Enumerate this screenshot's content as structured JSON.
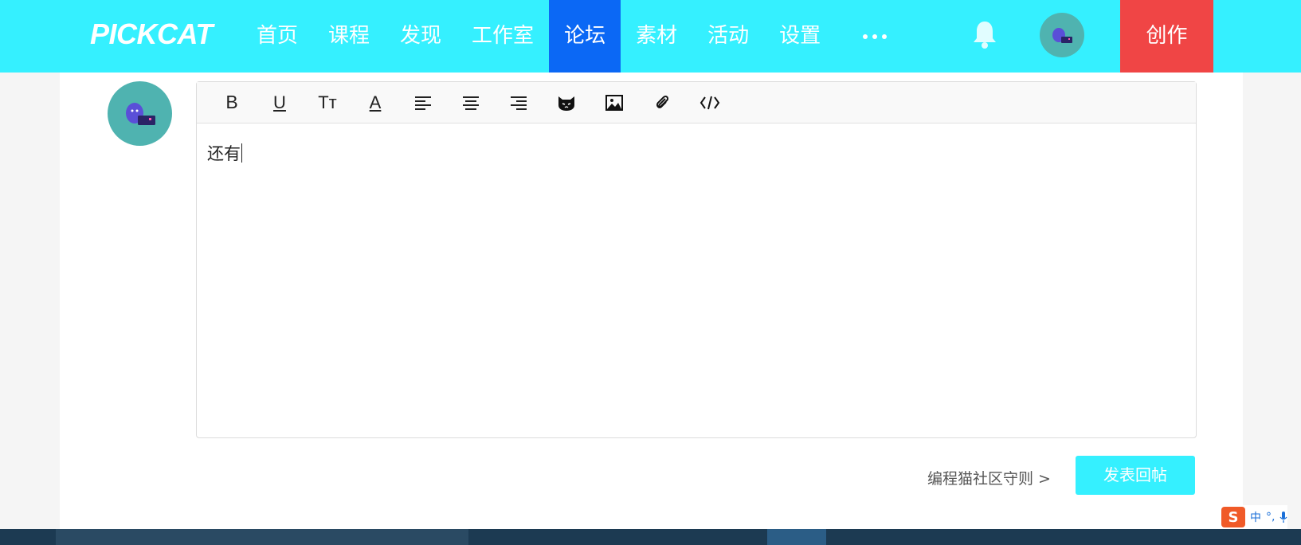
{
  "header": {
    "logo": "PICKCAT",
    "nav": [
      {
        "label": "首页",
        "active": false
      },
      {
        "label": "课程",
        "active": false
      },
      {
        "label": "发现",
        "active": false
      },
      {
        "label": "工作室",
        "active": false
      },
      {
        "label": "论坛",
        "active": true
      },
      {
        "label": "素材",
        "active": false
      },
      {
        "label": "活动",
        "active": false
      },
      {
        "label": "设置",
        "active": false
      }
    ],
    "more_icon": "more-dots-icon",
    "bell_icon": "bell-icon",
    "create_label": "创作"
  },
  "editor": {
    "toolbar": [
      {
        "icon": "bold-icon",
        "glyph": "B"
      },
      {
        "icon": "underline-icon",
        "glyph": "U"
      },
      {
        "icon": "text-size-icon",
        "glyph": "Tт"
      },
      {
        "icon": "font-color-icon",
        "glyph": "A"
      },
      {
        "icon": "align-left-icon"
      },
      {
        "icon": "align-center-icon"
      },
      {
        "icon": "align-right-icon"
      },
      {
        "icon": "emoji-cat-icon"
      },
      {
        "icon": "image-icon"
      },
      {
        "icon": "attachment-icon"
      },
      {
        "icon": "code-icon"
      }
    ],
    "content": "还有"
  },
  "footer": {
    "rules_link": "编程猫社区守则 >",
    "reply_button": "发表回帖"
  },
  "ime": {
    "logo": "S",
    "mode": "中",
    "punct": "°,"
  },
  "colors": {
    "header_bg": "#35f0ff",
    "nav_active_bg": "#0b68f5",
    "create_bg": "#f04545",
    "avatar_bg": "#4fb3b0",
    "reply_bg": "#35f0ff"
  }
}
